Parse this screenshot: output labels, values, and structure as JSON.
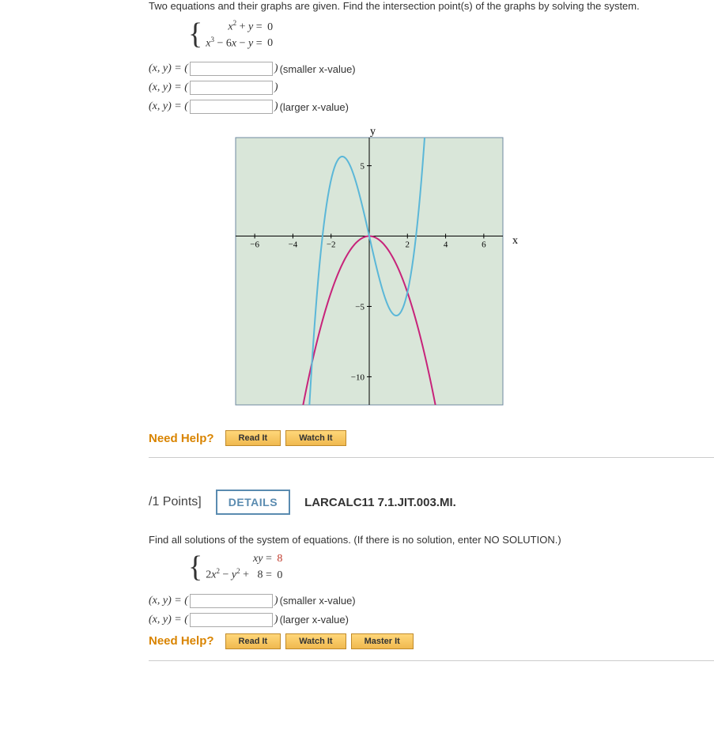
{
  "q1": {
    "prompt": "Two equations and their graphs are given. Find the intersection point(s) of the graphs by solving the system.",
    "equations": {
      "eq1_lhs": "x² + y",
      "eq1_rhs": "0",
      "eq2_lhs": "x³ − 6x − y",
      "eq2_rhs": "0"
    },
    "answers": [
      {
        "prefix": "(x, y) = (",
        "suffix": ")",
        "note": "(smaller x-value)"
      },
      {
        "prefix": "(x, y) = (",
        "suffix": ")",
        "note": ""
      },
      {
        "prefix": "(x, y) = (",
        "suffix": ")",
        "note": "(larger x-value)"
      }
    ],
    "help": {
      "label": "Need Help?",
      "buttons": [
        "Read It",
        "Watch It"
      ]
    }
  },
  "chart_data": {
    "type": "line",
    "title": "",
    "xlabel": "x",
    "ylabel": "y",
    "xlim": [
      -7,
      7
    ],
    "ylim": [
      -12,
      7
    ],
    "xticks": [
      -6,
      -4,
      -2,
      2,
      4,
      6
    ],
    "yticks": [
      -10,
      -5,
      5
    ],
    "series": [
      {
        "name": "y = -x^2",
        "color": "#c7237a",
        "x": [
          -4,
          -3,
          -2,
          -1,
          0,
          1,
          2,
          3,
          4
        ],
        "y": [
          -16,
          -9,
          -4,
          -1,
          0,
          -1,
          -4,
          -9,
          -16
        ]
      },
      {
        "name": "y = x^3 - 6x",
        "color": "#5bb7d8",
        "x": [
          -3,
          -2.5,
          -2,
          -1.5,
          -1,
          -0.5,
          0,
          0.5,
          1,
          1.5,
          2,
          2.5,
          3
        ],
        "y": [
          -9,
          -0.625,
          4,
          5.625,
          5,
          2.875,
          0,
          -2.875,
          -5,
          -5.625,
          -4,
          0.625,
          9
        ]
      }
    ]
  },
  "q2": {
    "header": {
      "points": "/1 Points]",
      "details": "DETAILS",
      "ref": "LARCALC11 7.1.JIT.003.MI."
    },
    "prompt": "Find all solutions of the system of equations. (If there is no solution, enter NO SOLUTION.)",
    "equations": {
      "eq1_lhs": "xy",
      "eq1_rhs": "8",
      "eq2_lhs": "2x² − y² +   8",
      "eq2_rhs": "0"
    },
    "answers": [
      {
        "prefix": "(x, y) = (",
        "suffix": ")",
        "note": "(smaller x-value)"
      },
      {
        "prefix": "(x, y) = (",
        "suffix": ")",
        "note": "(larger x-value)"
      }
    ],
    "help": {
      "label": "Need Help?",
      "buttons": [
        "Read It",
        "Watch It",
        "Master It"
      ]
    }
  }
}
